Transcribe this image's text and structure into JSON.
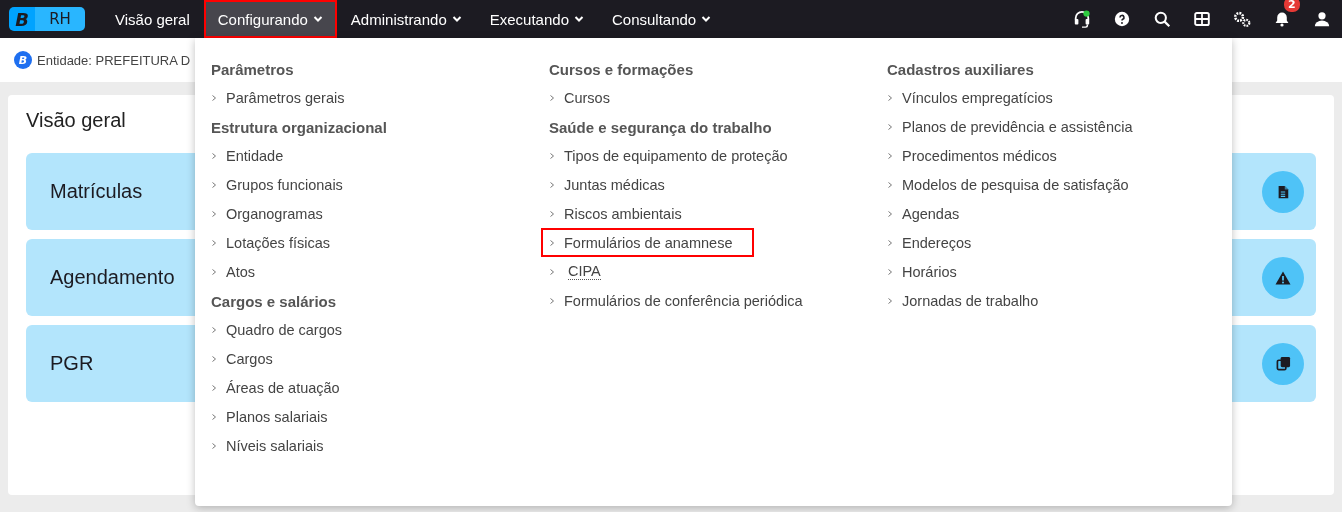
{
  "topbar": {
    "logo_letter": "B",
    "app_name": "RH",
    "nav": [
      {
        "label": "Visão geral",
        "has_menu": false,
        "selected": false,
        "highlighted": false
      },
      {
        "label": "Configurando",
        "has_menu": true,
        "selected": true,
        "highlighted": true
      },
      {
        "label": "Administrando",
        "has_menu": true,
        "selected": false,
        "highlighted": false
      },
      {
        "label": "Executando",
        "has_menu": true,
        "selected": false,
        "highlighted": false
      },
      {
        "label": "Consultando",
        "has_menu": true,
        "selected": false,
        "highlighted": false
      }
    ],
    "notification_count": "2"
  },
  "entity_bar": {
    "badge": "B",
    "text": "Entidade: PREFEITURA D"
  },
  "page": {
    "title": "Visão geral",
    "cards": [
      {
        "label": "Matrículas",
        "kind": "document"
      },
      {
        "label": "Agendamento",
        "kind": "warning"
      },
      {
        "label": "PGR",
        "kind": "copy"
      }
    ]
  },
  "menu": {
    "columns": [
      {
        "groups": [
          {
            "title": "Parâmetros",
            "items": [
              {
                "label": "Parâmetros gerais",
                "highlighted": false,
                "underlined": false
              }
            ]
          },
          {
            "title": "Estrutura organizacional",
            "items": [
              {
                "label": "Entidade",
                "highlighted": false,
                "underlined": false
              },
              {
                "label": "Grupos funcionais",
                "highlighted": false,
                "underlined": false
              },
              {
                "label": "Organogramas",
                "highlighted": false,
                "underlined": false
              },
              {
                "label": "Lotações físicas",
                "highlighted": false,
                "underlined": false
              },
              {
                "label": "Atos",
                "highlighted": false,
                "underlined": false
              }
            ]
          },
          {
            "title": "Cargos e salários",
            "items": [
              {
                "label": "Quadro de cargos",
                "highlighted": false,
                "underlined": false
              },
              {
                "label": "Cargos",
                "highlighted": false,
                "underlined": false
              },
              {
                "label": "Áreas de atuação",
                "highlighted": false,
                "underlined": false
              },
              {
                "label": "Planos salariais",
                "highlighted": false,
                "underlined": false
              },
              {
                "label": "Níveis salariais",
                "highlighted": false,
                "underlined": false
              }
            ]
          }
        ]
      },
      {
        "groups": [
          {
            "title": "Cursos e formações",
            "items": [
              {
                "label": "Cursos",
                "highlighted": false,
                "underlined": false
              }
            ]
          },
          {
            "title": "Saúde e segurança do trabalho",
            "items": [
              {
                "label": "Tipos de equipamento de proteção",
                "highlighted": false,
                "underlined": false
              },
              {
                "label": "Juntas médicas",
                "highlighted": false,
                "underlined": false
              },
              {
                "label": "Riscos ambientais",
                "highlighted": false,
                "underlined": false
              },
              {
                "label": "Formulários de anamnese",
                "highlighted": true,
                "underlined": false
              },
              {
                "label": "CIPA",
                "highlighted": false,
                "underlined": true
              },
              {
                "label": "Formulários de conferência periódica",
                "highlighted": false,
                "underlined": false
              }
            ]
          }
        ]
      },
      {
        "groups": [
          {
            "title": "Cadastros auxiliares",
            "items": [
              {
                "label": "Vínculos empregatícios",
                "highlighted": false,
                "underlined": false
              },
              {
                "label": "Planos de previdência e assistência",
                "highlighted": false,
                "underlined": false
              },
              {
                "label": "Procedimentos médicos",
                "highlighted": false,
                "underlined": false
              },
              {
                "label": "Modelos de pesquisa de satisfação",
                "highlighted": false,
                "underlined": false
              },
              {
                "label": "Agendas",
                "highlighted": false,
                "underlined": false
              },
              {
                "label": "Endereços",
                "highlighted": false,
                "underlined": false
              },
              {
                "label": "Horários",
                "highlighted": false,
                "underlined": false
              },
              {
                "label": "Jornadas de trabalho",
                "highlighted": false,
                "underlined": false
              }
            ]
          }
        ]
      }
    ]
  }
}
